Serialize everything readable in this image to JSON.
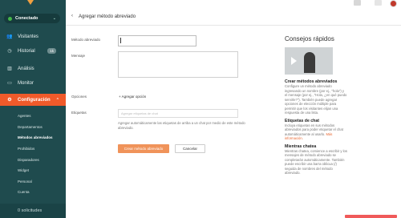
{
  "sidebar": {
    "status_label": "Conectado",
    "items": [
      {
        "label": "Visitantes",
        "icon": "users-icon"
      },
      {
        "label": "Historial",
        "icon": "history-icon",
        "badge": "1k"
      },
      {
        "label": "Análisis",
        "icon": "chart-icon"
      },
      {
        "label": "Monitor",
        "icon": "monitor-icon"
      },
      {
        "label": "Configuración",
        "icon": "gear-icon"
      }
    ],
    "sub_items": [
      "Agentes",
      "Departamentos",
      "Métodos abreviados",
      "Prohibidos",
      "Disparadores",
      "Widget",
      "Personal",
      "Cuenta"
    ],
    "bottom_label": "0 solicitudes"
  },
  "header": {
    "title": "Agregar método abreviado"
  },
  "form": {
    "name_label": "Método abreviado",
    "message_label": "Mensaje",
    "options_label": "Opciones",
    "add_option": "+ Agregar opción",
    "tags_label": "Etiquetas",
    "tags_placeholder": "Agregar etiquetas de chat",
    "help_text": "Agregar automáticamente las etiquetas de arriba a un chat por medio de este método abreviado.",
    "create_button": "Crear método abreviado",
    "cancel_button": "Cancelar"
  },
  "tips": {
    "title": "Consejos rápidos",
    "sections": [
      {
        "heading": "Crear métodos abreviados",
        "body": "Configure un método abreviado ingresando un nombre (por ej., \"hola\") y el mensaje (por ej., \"Hola, ¿en qué puedo servirle?\"). También puede agregar opciones de elección múltiple para permitir que los visitantes elijan una respuesta de una lista."
      },
      {
        "heading": "Etiquetas de chat",
        "body": "Incluya etiquetas en sus métodos abreviados para poder etiquetar el chat automáticamente al usarlo.",
        "link": "Más información."
      },
      {
        "heading": "Mientras chatea",
        "body": "Mientras chatea, comience a escribir y los mensajes de método abreviado se completarán automáticamente. También puede escribir una barra oblicua (/) seguida de nombres del método abreviado."
      }
    ]
  },
  "colors": {
    "sidebar_bg": "#1f4b4e",
    "accent": "#f05a2a",
    "button_primary": "#f0935a"
  }
}
